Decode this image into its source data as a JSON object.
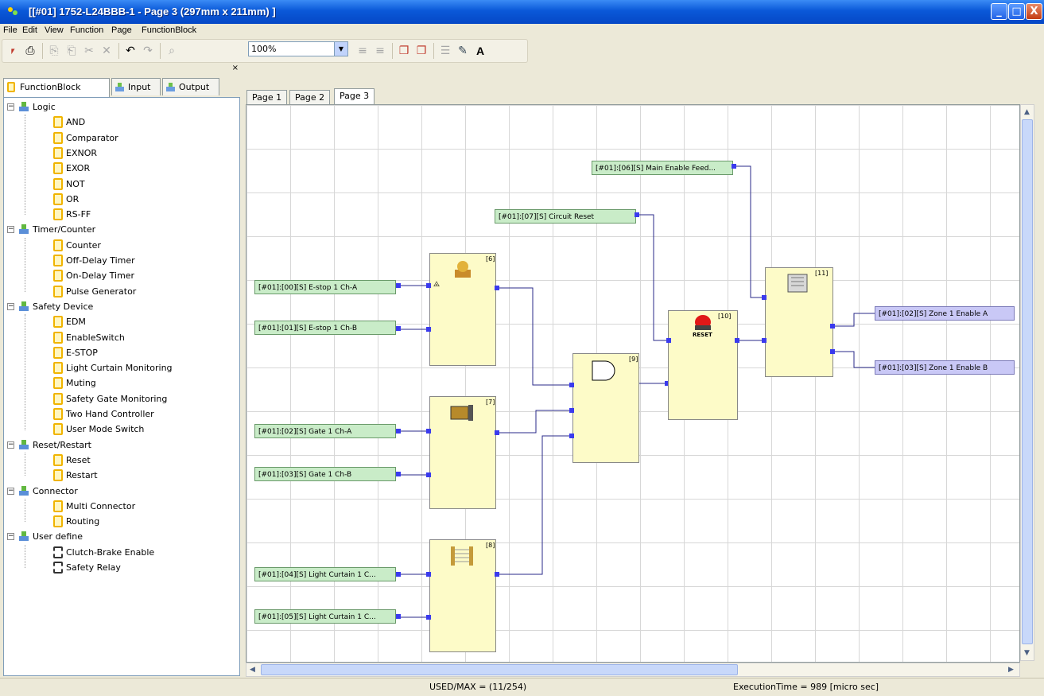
{
  "window": {
    "title": "[[#01] 1752-L24BBB-1 - Page 3 (297mm x 211mm) ]",
    "min_glyph": "_",
    "max_glyph": "□",
    "close_glyph": "X"
  },
  "menu": [
    "File",
    "Edit",
    "View",
    "Function",
    "Page",
    "FunctionBlock"
  ],
  "toolbar": {
    "zoom_value": "100%",
    "text_tool_label": "A"
  },
  "panel": {
    "close_glyph": "×",
    "tabs": [
      "FunctionBlock",
      "Input",
      "Output"
    ],
    "tree": [
      {
        "label": "Logic",
        "children": [
          "AND",
          "Comparator",
          "EXNOR",
          "EXOR",
          "NOT",
          "OR",
          "RS-FF"
        ]
      },
      {
        "label": "Timer/Counter",
        "children": [
          "Counter",
          "Off-Delay Timer",
          "On-Delay Timer",
          "Pulse Generator"
        ]
      },
      {
        "label": "Safety Device",
        "children": [
          "EDM",
          "EnableSwitch",
          "E-STOP",
          "Light Curtain Monitoring",
          "Muting",
          "Safety Gate Monitoring",
          "Two Hand Controller",
          "User Mode Switch"
        ]
      },
      {
        "label": "Reset/Restart",
        "children": [
          "Reset",
          "Restart"
        ]
      },
      {
        "label": "Connector",
        "children": [
          "Multi Connector",
          "Routing"
        ]
      },
      {
        "label": "User define",
        "children": [
          "Clutch-Brake Enable",
          "Safety Relay"
        ]
      }
    ]
  },
  "doc_tabs": [
    "Page 1",
    "Page 2",
    "Page 3"
  ],
  "canvas": {
    "inputs": {
      "main_enable": "[#01]:[06][S] Main Enable Feed...",
      "circuit_reset": "[#01]:[07][S] Circuit Reset",
      "estop_a": "[#01]:[00][S] E-stop 1 Ch-A",
      "estop_b": "[#01]:[01][S] E-stop 1 Ch-B",
      "gate_a": "[#01]:[02][S] Gate 1 Ch-A",
      "gate_b": "[#01]:[03][S] Gate 1 Ch-B",
      "lc_a": "[#01]:[04][S] Light Curtain 1 C...",
      "lc_b": "[#01]:[05][S] Light Curtain 1 C..."
    },
    "outputs": {
      "zone_a": "[#01]:[02][S] Zone 1 Enable A",
      "zone_b": "[#01]:[03][S] Zone 1 Enable B"
    },
    "blocks": {
      "estop": "[6]",
      "gate": "[7]",
      "lc": "[8]",
      "and": "[9]",
      "reset": "[10]",
      "edm": "[11]"
    },
    "reset_text": "RESET"
  },
  "status": {
    "used": "USED/MAX = (11/254)",
    "exec": "ExecutionTime = 989 [micro sec]"
  }
}
